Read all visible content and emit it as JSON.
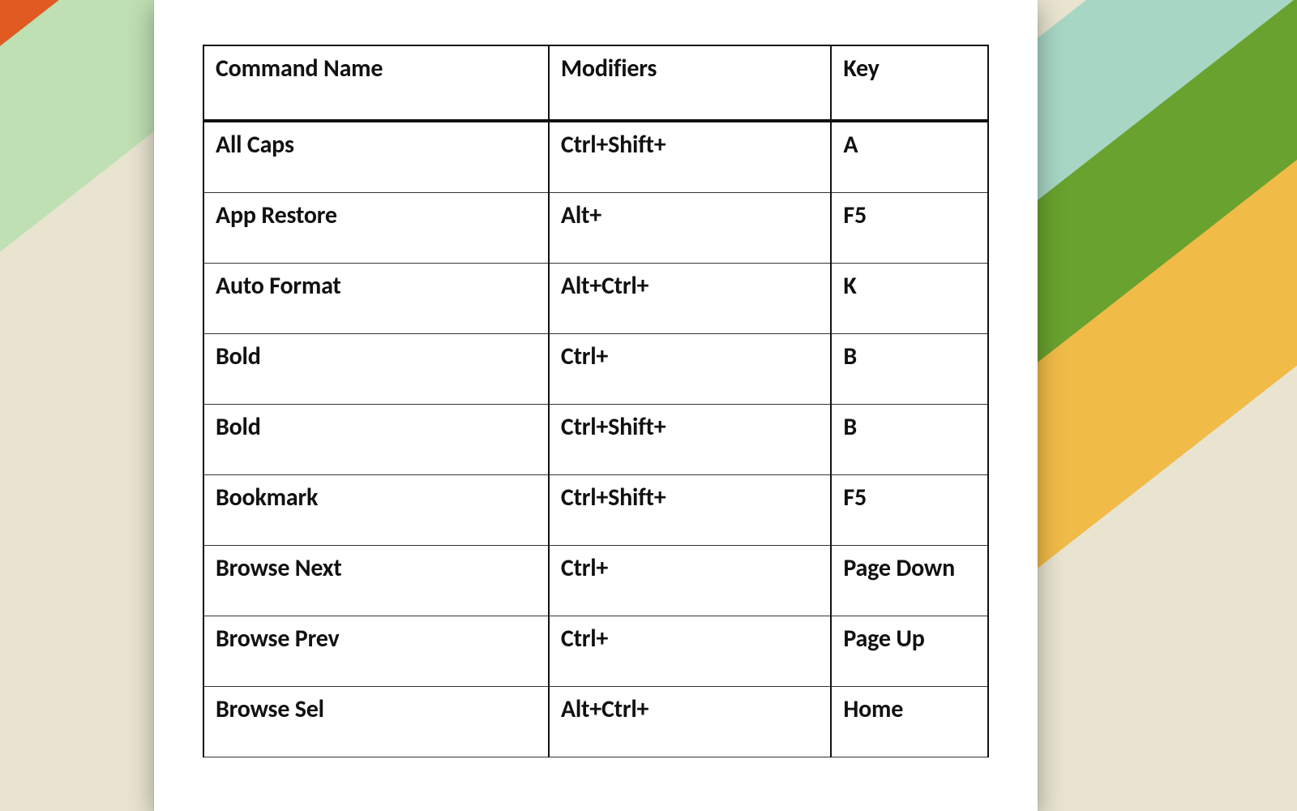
{
  "background": {
    "base": "#e8e4d0",
    "stripes": [
      {
        "color": "#5da333"
      },
      {
        "color": "#f1bb47"
      },
      {
        "color": "#e05a22"
      },
      {
        "color": "#bfe0b3"
      },
      {
        "color": "#a7d6c4"
      },
      {
        "color": "#69a22e"
      },
      {
        "color": "#f1bb47"
      }
    ]
  },
  "table": {
    "headers": {
      "command": "Command Name",
      "modifiers": "Modifiers",
      "key": "Key"
    },
    "rows": [
      {
        "command": "All Caps",
        "modifiers": "Ctrl+Shift+",
        "key": "A"
      },
      {
        "command": "App Restore",
        "modifiers": "Alt+",
        "key": "F5"
      },
      {
        "command": "Auto Format",
        "modifiers": "Alt+Ctrl+",
        "key": "K"
      },
      {
        "command": "Bold",
        "modifiers": "Ctrl+",
        "key": "B"
      },
      {
        "command": "Bold",
        "modifiers": "Ctrl+Shift+",
        "key": "B"
      },
      {
        "command": "Bookmark",
        "modifiers": "Ctrl+Shift+",
        "key": "F5"
      },
      {
        "command": "Browse Next",
        "modifiers": "Ctrl+",
        "key": "Page Down"
      },
      {
        "command": "Browse Prev",
        "modifiers": "Ctrl+",
        "key": "Page Up"
      },
      {
        "command": "Browse Sel",
        "modifiers": "Alt+Ctrl+",
        "key": "Home"
      }
    ]
  }
}
